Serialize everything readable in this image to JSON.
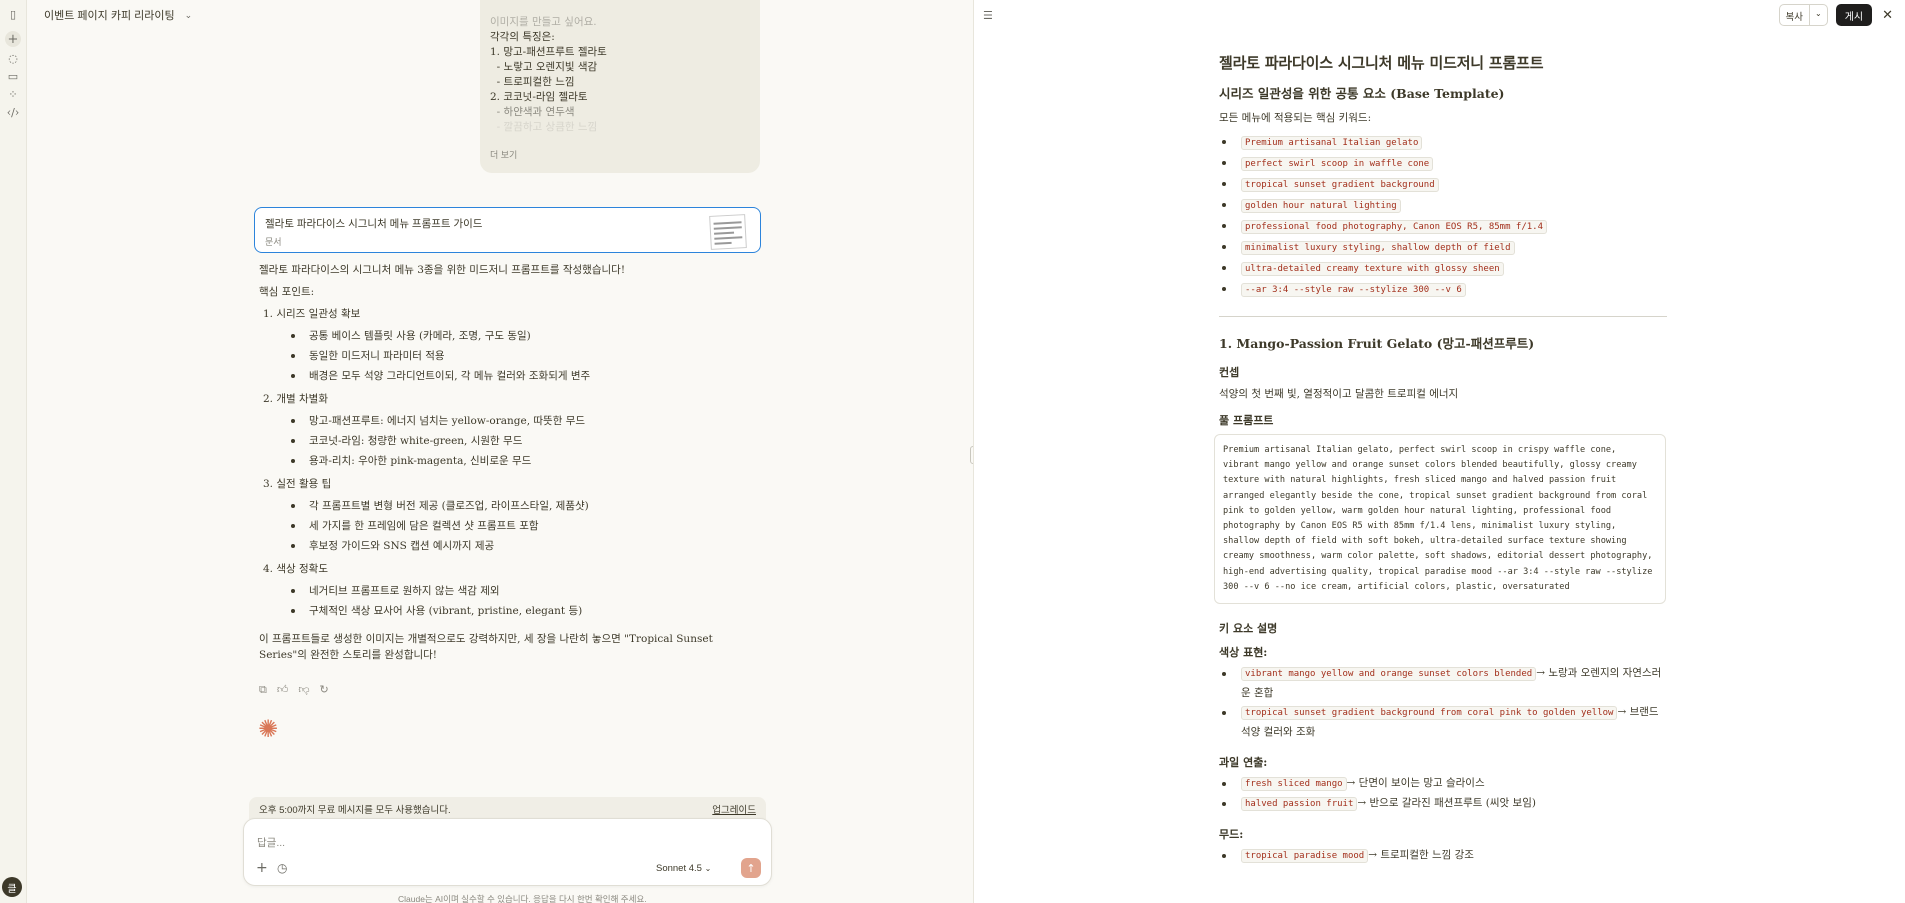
{
  "project": {
    "title": "이벤트 페이지 카피 리라이팅"
  },
  "rail": {
    "avatar_letter": "클"
  },
  "user_message": {
    "lines": [
      "이미지를 만들고 싶어요.",
      "각각의 특징은:",
      "1. 망고-패션프루트 젤라토",
      "  - 노랗고 오렌지빛 색감",
      "  - 트로피컬한 느낌",
      "2. 코코넛-라임 젤라토",
      "  - 하얀색과 연두색",
      "  - 깔끔하고 상큼한 느낌"
    ],
    "more_label": "더 보기"
  },
  "artifact": {
    "title": "젤라토 파라다이스 시그니처 메뉴 프롬프트 가이드",
    "type": "문서"
  },
  "reply": {
    "intro": "젤라토 파라다이스의 시그니처 메뉴 3종을 위한 미드저니 프롬프트를 작성했습니다!",
    "heading": "핵심 포인트:",
    "sections": [
      {
        "title": "1.  시리즈 일관성 확보",
        "items": [
          "공통 베이스 템플릿 사용 (카메라, 조명, 구도 동일)",
          "동일한 미드저니 파라미터 적용",
          "배경은 모두 석양 그라디언트이되, 각 메뉴 컬러와 조화되게 변주"
        ]
      },
      {
        "title": "2.  개별 차별화",
        "items": [
          "망고-패션프루트: 에너지 넘치는 yellow-orange, 따뜻한 무드",
          "코코넛-라임: 청량한 white-green, 시원한 무드",
          "용과-리치: 우아한 pink-magenta, 신비로운 무드"
        ]
      },
      {
        "title": "3.  실전 활용 팁",
        "items": [
          "각 프롬프트별 변형 버전 제공 (클로즈업, 라이프스타일, 제품샷)",
          "세 가지를 한 프레임에 담은 컬렉션 샷 프롬프트 포함",
          "후보정 가이드와 SNS 캡션 예시까지 제공"
        ]
      },
      {
        "title": "4.  색상 정확도",
        "items": [
          "네거티브 프롬프트로 원하지 않는 색감 제외",
          "구체적인 색상 묘사어 사용 (vibrant, pristine, elegant 등)"
        ]
      }
    ],
    "outro": "이 프롬프트들로 생성한 이미지는 개별적으로도 강력하지만, 세 장을 나란히 놓으면 \"Tropical Sunset Series\"의 완전한 스토리를 완성합니다!"
  },
  "actions": {
    "copy_icon": "copy-icon",
    "up_icon": "thumbs-up-icon",
    "down_icon": "thumbs-down-icon",
    "retry_icon": "retry-icon"
  },
  "limit": {
    "text": "오후 5:00까지 무료 메시지를 모두 사용했습니다.",
    "link": "업그레이드"
  },
  "composer": {
    "placeholder": "답글...",
    "model": "Sonnet 4.5"
  },
  "disclaimer": "Claude는 AI이며 실수할 수 있습니다. 응답을 다시 한번 확인해 주세요.",
  "doc": {
    "toolbar": {
      "copy": "복사",
      "publish": "게시"
    },
    "title": "젤라토 파라다이스 시그니처 메뉴 미드저니 프롬프트",
    "base_heading": "시리즈 일관성을 위한 공통 요소 (Base Template)",
    "base_intro": "모든 메뉴에 적용되는 핵심 키워드:",
    "keywords": [
      "Premium artisanal Italian gelato",
      "perfect swirl scoop in waffle cone",
      "tropical sunset gradient background",
      "golden hour natural lighting",
      "professional food photography, Canon EOS R5, 85mm f/1.4",
      "minimalist luxury styling, shallow depth of field",
      "ultra-detailed creamy texture with glossy sheen",
      "--ar 3:4 --style raw --stylize 300 --v 6"
    ],
    "section1_title": "1. Mango-Passion Fruit Gelato (망고-패션프루트)",
    "concept_label": "컨셉",
    "concept_text": "석양의 첫 번째 빛, 열정적이고 달콤한 트로피컬 에너지",
    "full_prompt_label": "풀 프롬프트",
    "full_prompt": "Premium artisanal Italian gelato, perfect swirl scoop in crispy waffle cone, vibrant mango yellow and orange sunset colors blended beautifully, glossy creamy texture with natural highlights, fresh sliced mango and halved passion fruit arranged elegantly beside the cone, tropical sunset gradient background from coral pink to golden yellow, warm golden hour natural lighting, professional food photography by Canon EOS R5 with 85mm f/1.4 lens, minimalist luxury styling, shallow depth of field with soft bokeh, ultra-detailed surface texture showing creamy smoothness, warm color palette, soft shadows, editorial dessert photography, high-end advertising quality, tropical paradise mood --ar 3:4 --style raw --stylize 300 --v 6 --no ice cream, artificial colors, plastic, oversaturated",
    "key_label": "키 요소 설명",
    "color_label": "색상 표현:",
    "color_items": [
      {
        "code": "vibrant mango yellow and orange sunset colors blended",
        "text": "→ 노랑과 오렌지의 자연스러운 혼합"
      },
      {
        "code": "tropical sunset gradient background from coral pink to golden yellow",
        "text": "→ 브랜드 석양 컬러와 조화"
      }
    ],
    "fruit_label": "과일 연출:",
    "fruit_items": [
      {
        "code": "fresh sliced mango",
        "text": "→ 단면이 보이는 망고 슬라이스"
      },
      {
        "code": "halved passion fruit",
        "text": "→ 반으로 갈라진 패션프루트 (씨앗 보임)"
      }
    ],
    "mood_label": "무드:",
    "mood_items": [
      {
        "code": "tropical paradise mood",
        "text": "→ 트로피컬한 느낌 강조"
      }
    ]
  }
}
